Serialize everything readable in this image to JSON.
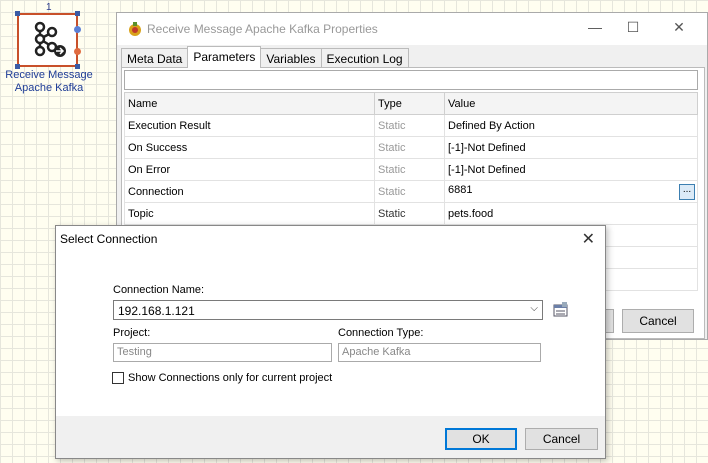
{
  "canvas": {
    "node_number": "1",
    "node_label_line1": "Receive Message",
    "node_label_line2": "Apache Kafka",
    "node_icon": "kafka-icon"
  },
  "properties_window": {
    "title": "Receive Message Apache Kafka Properties",
    "minimize": "—",
    "maximize": "☐",
    "close": "✕",
    "tabs": [
      "Meta Data",
      "Parameters",
      "Variables",
      "Execution Log"
    ],
    "active_tab": "Parameters",
    "columns": [
      "Name",
      "Type",
      "Value"
    ],
    "rows": [
      {
        "name": "Execution Result",
        "type": "Static",
        "value": "Defined By Action"
      },
      {
        "name": "On Success",
        "type": "Static",
        "value": "[-1]-Not Defined"
      },
      {
        "name": "On Error",
        "type": "Static",
        "value": "[-1]-Not Defined"
      },
      {
        "name": "Connection",
        "type": "Static",
        "value": "6881"
      },
      {
        "name": "Topic",
        "type": "Static",
        "value": "pets.food"
      }
    ],
    "ellipsis": "...",
    "cancel_label": "Cancel"
  },
  "select_connection": {
    "title": "Select Connection",
    "close": "✕",
    "connection_name_label": "Connection Name:",
    "connection_name_value": "192.168.1.121",
    "combo_arrow": "⌵",
    "project_label": "Project:",
    "project_value": "Testing",
    "connection_type_label": "Connection Type:",
    "connection_type_value": "Apache Kafka",
    "checkbox_label": "Show Connections only for current project",
    "checkbox_checked": false,
    "ok_label": "OK",
    "cancel_label": "Cancel"
  },
  "colors": {
    "node_border": "#c8502a",
    "accent": "#0078d7",
    "label_blue": "#1e3c96"
  }
}
